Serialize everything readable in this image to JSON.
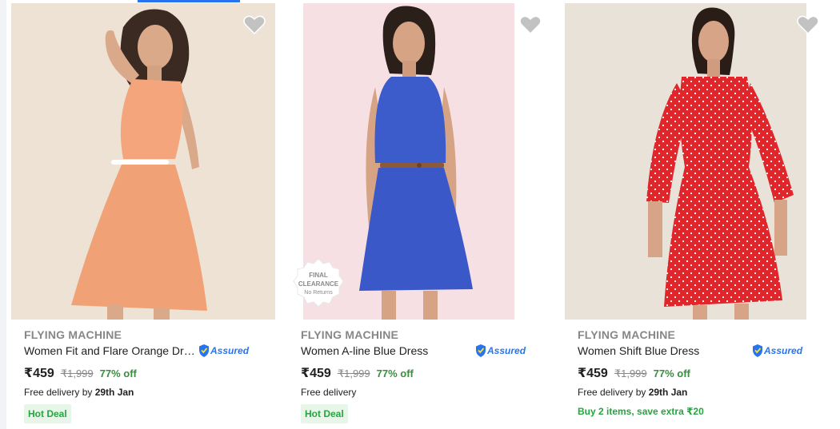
{
  "products": [
    {
      "brand": "FLYING MACHINE",
      "title": "Women Fit and Flare Orange Dre...",
      "assured": "Assured",
      "price": "₹459",
      "mrp": "₹1,999",
      "discount": "77% off",
      "delivery_prefix": "Free delivery by ",
      "delivery_date": "29th Jan",
      "deal": "Hot Deal",
      "dress_color": "#f4a57c",
      "icon": "heart-icon"
    },
    {
      "brand": "FLYING MACHINE",
      "title": "Women A-line Blue Dress",
      "assured": "Assured",
      "price": "₹459",
      "mrp": "₹1,999",
      "discount": "77% off",
      "delivery_prefix": "Free delivery",
      "delivery_date": "",
      "deal": "Hot Deal",
      "badge_line1": "FINAL",
      "badge_line2": "CLEARANCE",
      "badge_line3": "No Returns",
      "dress_color": "#3d5ccc",
      "icon": "heart-icon"
    },
    {
      "brand": "FLYING MACHINE",
      "title": "Women Shift Blue Dress",
      "assured": "Assured",
      "price": "₹459",
      "mrp": "₹1,999",
      "discount": "77% off",
      "delivery_prefix": "Free delivery by ",
      "delivery_date": "29th Jan",
      "offer": "Buy 2 items, save extra ₹20",
      "dress_color": "#e0262b",
      "icon": "heart-icon"
    }
  ],
  "colors": {
    "accent": "#2874f0",
    "discount_green": "#388e3c",
    "deal_green": "#26a541",
    "deal_bg": "#e8f5e9"
  }
}
